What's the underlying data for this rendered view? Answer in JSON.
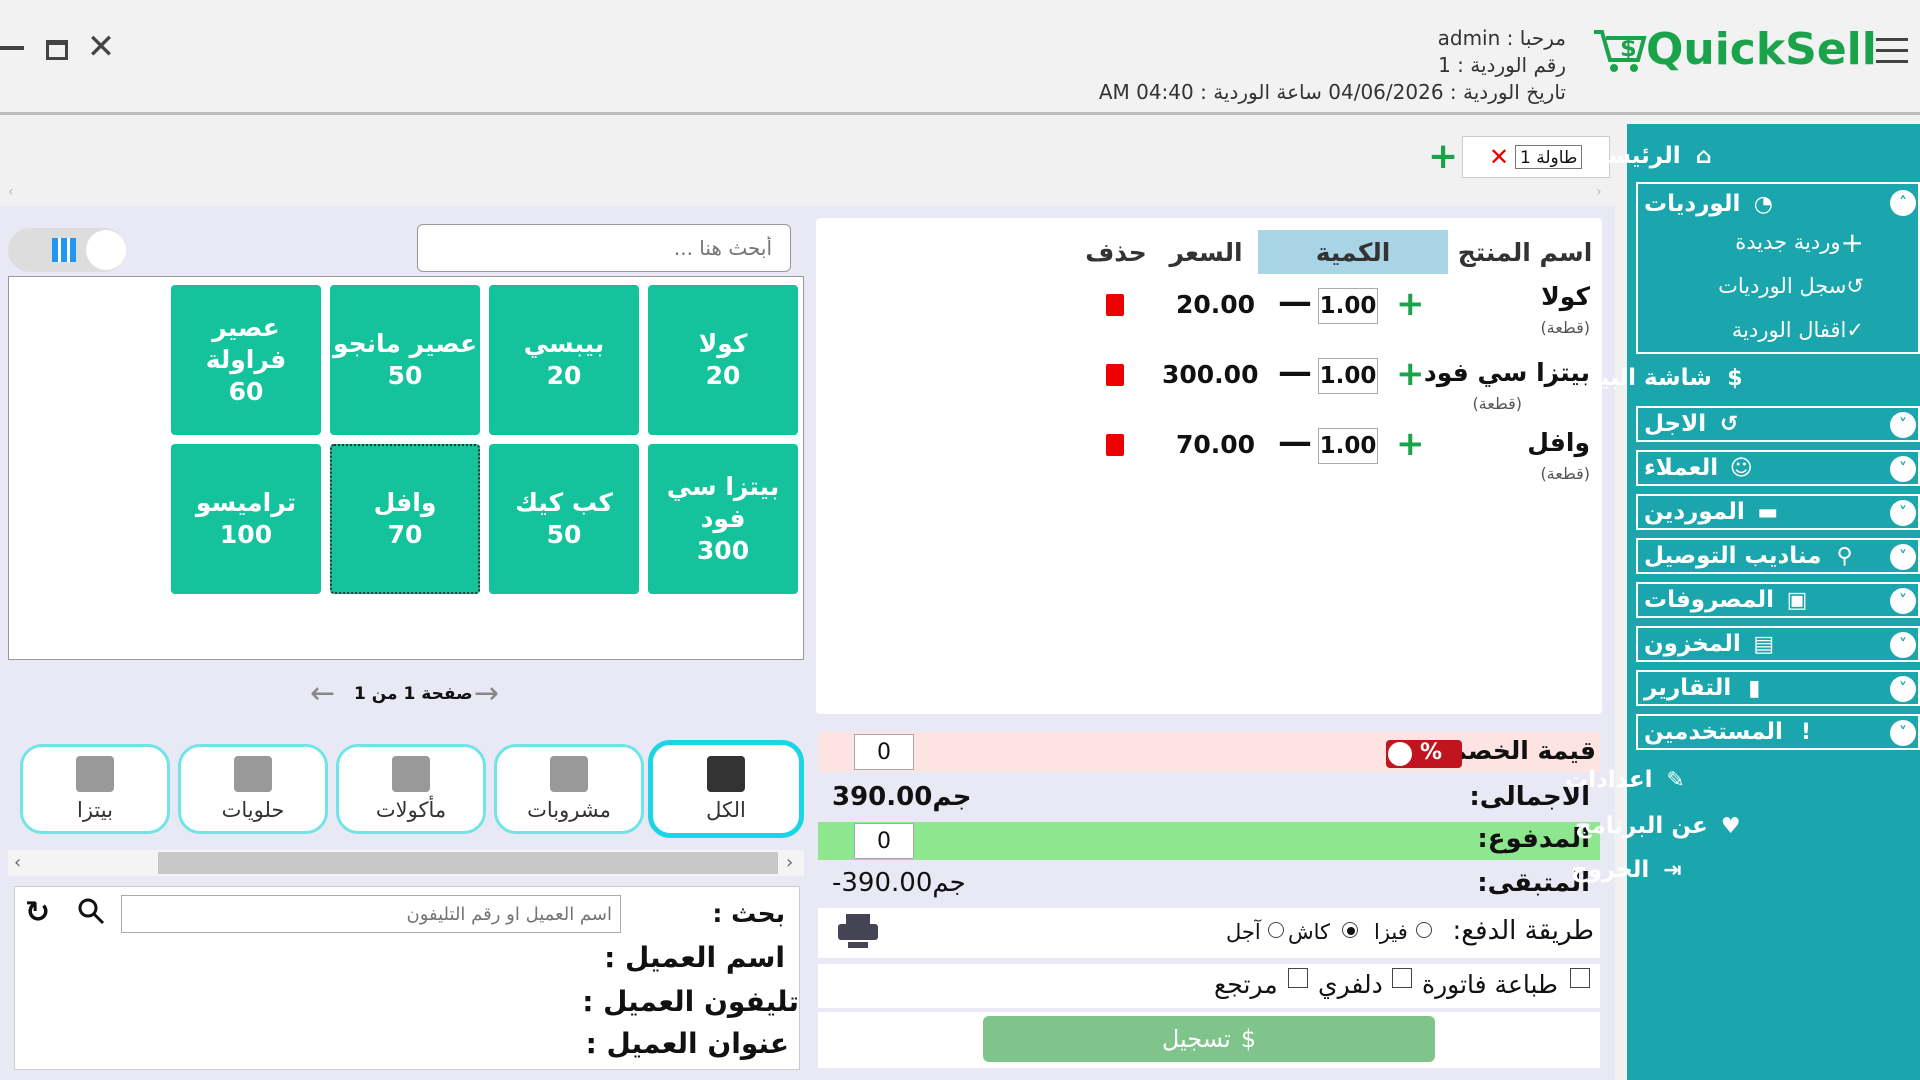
{
  "header": {
    "greeting_line": "مرحبا : admin",
    "shift_number_line": "رقم الوردية : 1",
    "shift_date_line": "تاريخ الوردية : 04/06/2026 ساعة الوردية : 04:40 AM",
    "logo_text": "QuickSell",
    "brand_color": "#1aa34a"
  },
  "sidebar": {
    "home": "الرئيسية",
    "shifts": "الورديات",
    "new_shift": "وردية جديدة",
    "shift_log": "سجل الورديات",
    "close_shift": "اقفال الوردية",
    "sales_screen": "شاشة البيع",
    "credit": "الاجل",
    "customers": "العملاء",
    "suppliers": "الموردين",
    "delivery": "مناديب التوصيل",
    "expenses": "المصروفات",
    "stock": "المخزون",
    "reports": "التقارير",
    "users": "المستخدمين",
    "settings": "اعدادات",
    "about": "عن البرنامج",
    "exit": "الخروج",
    "color": "#1ba6ae"
  },
  "tabs": {
    "table_tab": "1 طاولة"
  },
  "cart": {
    "col_product": "اسم المنتج",
    "col_qty": "الكمية",
    "col_price": "السعر",
    "col_delete": "حذف",
    "items": [
      {
        "name": "كولا",
        "unit": "(قطعة)",
        "qty": "1.00",
        "price": "20.00"
      },
      {
        "name": "بيتزا سي فود",
        "unit": "(قطعة)",
        "qty": "1.00",
        "price": "300.00"
      },
      {
        "name": "وافل",
        "unit": "(قطعة)",
        "qty": "1.00",
        "price": "70.00"
      }
    ]
  },
  "products": {
    "search_placeholder": "أبحث هنا ...",
    "items": [
      {
        "name": "كولا",
        "price": "20"
      },
      {
        "name": "بيبسي",
        "price": "20"
      },
      {
        "name": "عصير مانجو",
        "price": "50"
      },
      {
        "name": "عصير فراولة",
        "price": "60"
      },
      {
        "name": "بيتزا سي فود",
        "price": "300"
      },
      {
        "name": "كب كيك",
        "price": "50"
      },
      {
        "name": "وافل",
        "price": "70"
      },
      {
        "name": "تراميسو",
        "price": "100"
      }
    ],
    "pagination": "صفحة 1 من 1"
  },
  "categories": [
    "الكل",
    "مشروبات",
    "مأكولات",
    "حلويات",
    "بيتزا"
  ],
  "totals": {
    "discount_label": "قيمة الخصم",
    "discount_value": "0",
    "total_label": "الاجمالى:",
    "total_value": "390.00جم",
    "paid_label": "المدفوع:",
    "paid_value": "0",
    "remaining_label": "المتبقى:",
    "remaining_value": "-390.00جم",
    "payment_method_label": "طريقة الدفع:",
    "pay_visa": "فيزا",
    "pay_cash": "كاش",
    "pay_credit": "آجل",
    "print_invoice": "طباعة فاتورة",
    "delivery": "دلفري",
    "returned": "مرتجع",
    "submit": "تسجيل"
  },
  "customer": {
    "search_label": "بحث :",
    "search_placeholder": "اسم العميل او رقم التليفون",
    "name_label": "اسم العميل :",
    "phone_label": "تليفون العميل :",
    "address_label": "عنوان العميل :"
  }
}
